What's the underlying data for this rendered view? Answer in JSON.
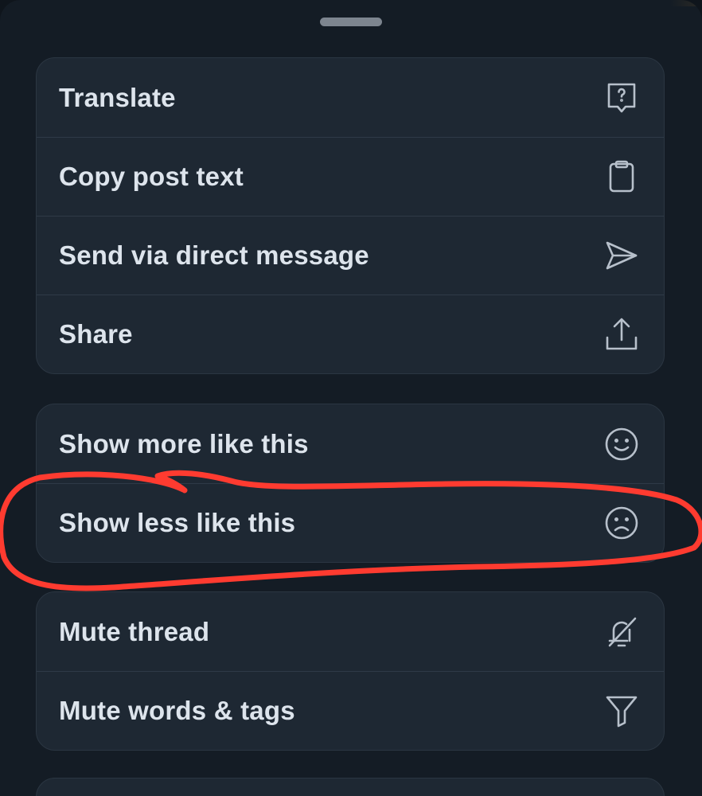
{
  "groups": [
    {
      "items": [
        {
          "label": "Translate",
          "icon": "translate-icon"
        },
        {
          "label": "Copy post text",
          "icon": "clipboard-icon"
        },
        {
          "label": "Send via direct message",
          "icon": "send-icon"
        },
        {
          "label": "Share",
          "icon": "share-icon"
        }
      ]
    },
    {
      "items": [
        {
          "label": "Show more like this",
          "icon": "smiley-icon"
        },
        {
          "label": "Show less like this",
          "icon": "frown-icon"
        }
      ]
    },
    {
      "items": [
        {
          "label": "Mute thread",
          "icon": "mute-bell-icon"
        },
        {
          "label": "Mute words & tags",
          "icon": "filter-icon"
        }
      ]
    }
  ],
  "colors": {
    "sheet_bg": "#141c25",
    "item_bg": "#1e2833",
    "text": "#dde4ec",
    "icon": "#b7c0cb",
    "annotation": "#ff3b30"
  }
}
